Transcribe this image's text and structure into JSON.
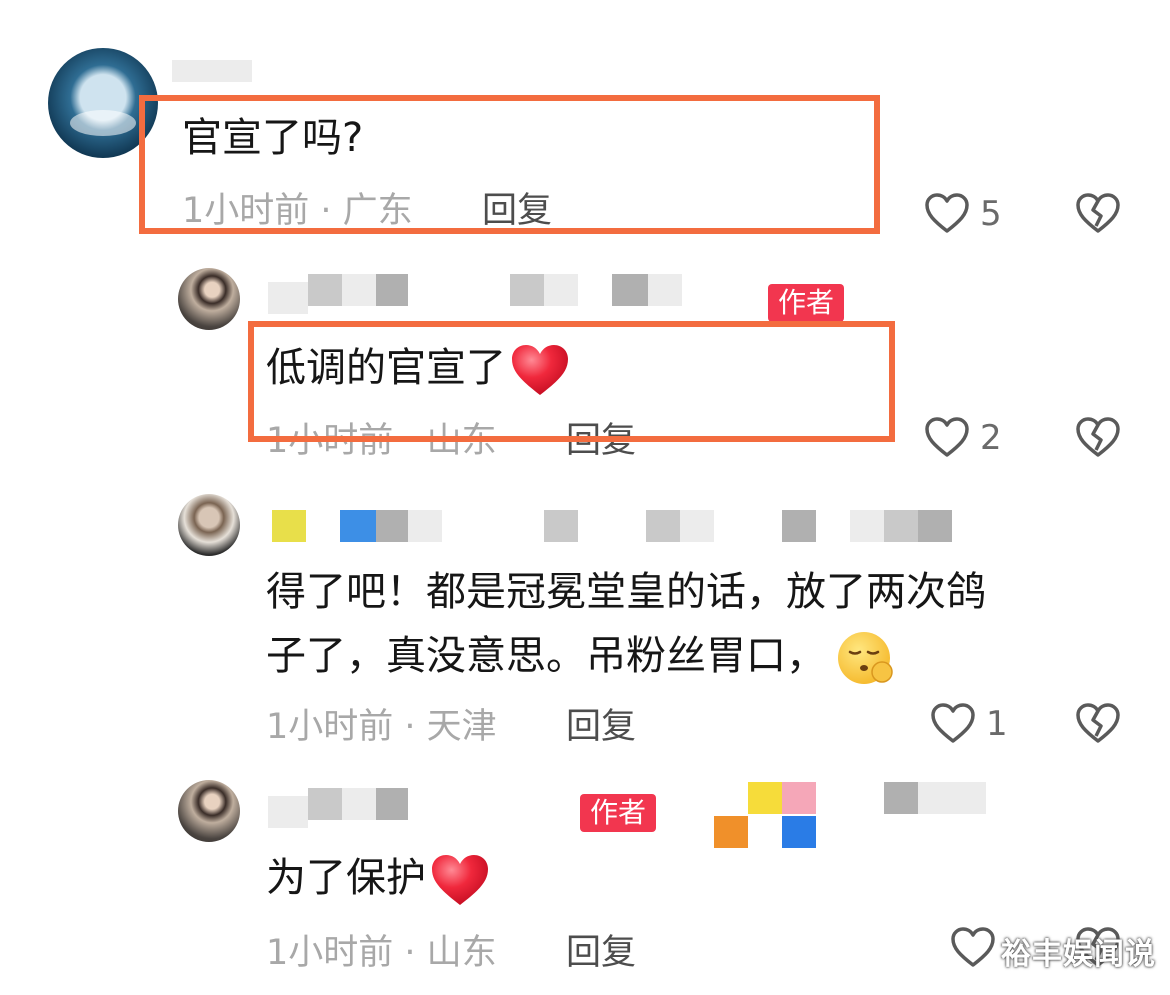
{
  "comments": [
    {
      "text": "官宣了吗?",
      "time_location": "1小时前 · 广东",
      "reply_label": "回复",
      "like_count": "5",
      "highlighted": true
    },
    {
      "badge": "作者",
      "text": "低调的官宣了",
      "time_location": "1小时前 · 山东",
      "reply_label": "回复",
      "like_count": "2",
      "highlighted": true
    },
    {
      "text_line1": "得了吧！都是冠冕堂皇的话，放了两次鸽",
      "text_line2": "子了，真没意思。吊粉丝胃口，",
      "time_location": "1小时前 · 天津",
      "reply_label": "回复",
      "like_count": "1"
    },
    {
      "badge": "作者",
      "text": "为了保护",
      "time_location": "1小时前 · 山东",
      "reply_label": "回复"
    }
  ],
  "icons": {
    "like": "heart-outline-icon",
    "dislike": "broken-heart-icon",
    "heart_emoji": "red-heart-emoji",
    "face_emoji": "pouting-face-emoji"
  },
  "colors": {
    "highlight": "#f36c3f",
    "badge": "#f2364f",
    "heart": "#f0283c"
  },
  "watermark": "裕丰娱闻说"
}
